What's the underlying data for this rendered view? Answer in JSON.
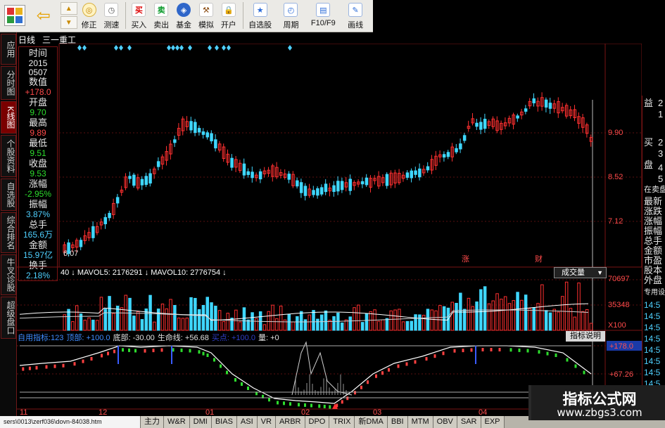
{
  "toolbar": {
    "buttons": [
      {
        "label": "修正",
        "icon": "refresh-icon"
      },
      {
        "label": "测速",
        "icon": "clock-icon"
      },
      {
        "label": "买入",
        "icon": "buy-icon",
        "glyph": "买"
      },
      {
        "label": "卖出",
        "icon": "sell-icon",
        "glyph": "卖"
      },
      {
        "label": "基金",
        "icon": "fund-icon"
      },
      {
        "label": "模拟",
        "icon": "hammer-icon"
      },
      {
        "label": "开户",
        "icon": "lock-icon"
      },
      {
        "label": "自选股",
        "icon": "favorite-stock-icon"
      },
      {
        "label": "周期",
        "icon": "period-icon"
      },
      {
        "label": "F10/F9",
        "icon": "f10-icon"
      },
      {
        "label": "画线",
        "icon": "pencil-icon"
      }
    ]
  },
  "left_tabs": [
    "应用",
    "分时图",
    "K线图",
    "个股资料",
    "自选股",
    "综合排名",
    "牛叉诊股",
    "超级盘口"
  ],
  "header": {
    "period": "日线",
    "stock_name": "三一重工"
  },
  "info_panel": {
    "time_label": "时间",
    "year": "2015",
    "date": "0507",
    "value_label": "数值",
    "value": "+178.0",
    "open_label": "开盘",
    "open": "9.70",
    "high_label": "最高",
    "high": "9.89",
    "low_label": "最低",
    "low": "9.51",
    "close_label": "收盘",
    "close": "9.53",
    "change_label": "涨幅",
    "change": "-2.95%",
    "amplitude_label": "振幅",
    "amplitude": "3.87%",
    "total_hand_label": "总手",
    "total_hand": "165.6万",
    "amount_label": "金额",
    "amount": "15.97亿",
    "turnover_label": "换手",
    "turnover": "2.18%"
  },
  "price_axis": {
    "p1": "9.90",
    "p2": "8.52",
    "p3": "7.12",
    "low_marker": "6.07"
  },
  "chart_tags": {
    "zhang": "涨",
    "cai": "财"
  },
  "volume": {
    "prefix": "40",
    "mavol5_label": "MAVOL5: 2176291",
    "mavol10_label": "MAVOL10: 2776754",
    "dropdown": "成交量",
    "axis_top": "70697",
    "axis_mid": "35348",
    "axis_unit": "X100"
  },
  "indicator": {
    "name": "自用指标:123",
    "top_label": "顶部: +100.0",
    "bottom_label": "底部: -30.00",
    "life_label": "生命线: +56.68",
    "buy_label": "买点: +100.0",
    "qty_label": "量: +0",
    "desc_button": "指标说明",
    "axis_top": "+178.0",
    "axis_mid": "+67.26"
  },
  "x_axis": {
    "m11": "11",
    "m12": "12",
    "m01": "01",
    "m02": "02",
    "m03": "03",
    "m04": "04"
  },
  "right_panel": {
    "r1": "益",
    "r2": "买",
    "r3": "盘",
    "n1": "2",
    "n2": "1",
    "n3": "2",
    "n4": "3",
    "n5": "4",
    "n6": "5",
    "in_sell": "在卖盘",
    "l1": "最新",
    "l2": "涨跌",
    "l3": "涨幅",
    "l4": "振幅",
    "l5": "总手",
    "l6": "金额",
    "l7": "市盈",
    "l8": "股本",
    "l9": "外盘",
    "dedicated": "专用设",
    "t1": "14:5",
    "t2": "14:5",
    "t3": "14:5",
    "t4": "14:5",
    "t5": "14:5",
    "t6": "14:5",
    "t7": "14:5",
    "t8": "14:5"
  },
  "bottom_tabs": [
    "sers\\0013\\zerf036\\dovn-84038.htm",
    "主力",
    "W&R",
    "DMI",
    "BIAS",
    "ASI",
    "VR",
    "ARBR",
    "DPO",
    "TRIX",
    "新DMA",
    "BBI",
    "MTM",
    "OBV",
    "SAR",
    "EXP"
  ],
  "watermark": {
    "title": "指标公式网",
    "url": "www.zbgs3.com"
  },
  "colors": {
    "up": "#ff3030",
    "down": "#3fd7ff",
    "grid": "#7a1414",
    "ma": "#ffffff"
  }
}
